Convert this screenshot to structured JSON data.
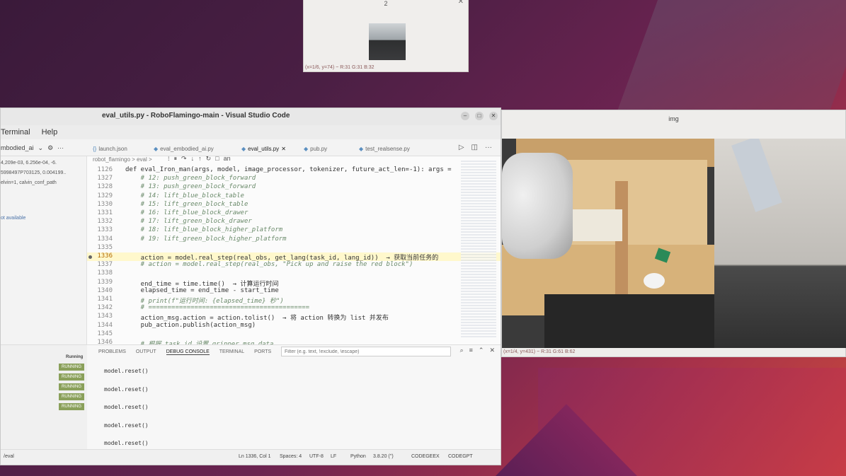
{
  "popup": {
    "title": "2",
    "status": "(x=1/6, y=74) ~ R:31 G:31 B:32"
  },
  "vscode": {
    "title": "eval_utils.py - RoboFlamingo-main - Visual Studio Code",
    "menu": [
      "Terminal",
      "Help"
    ],
    "explorer_label": "mbodied_ai",
    "tabs": [
      {
        "label": "launch.json",
        "active": false
      },
      {
        "label": "eval_embodied_ai.py",
        "active": false
      },
      {
        "label": "eval_utils.py",
        "active": true
      },
      {
        "label": "pub.py",
        "active": false
      },
      {
        "label": "test_realsense.py",
        "active": false
      }
    ],
    "breadcrumb": "robot_flamingo > eval >",
    "breadcrumb_tail": "an",
    "sidebar_lines": [
      "4,209e-03,  6.256e-04, -6.",
      "5998497P703125, 0.004199..",
      "elvin=1, calvin_conf_path",
      "ot available"
    ],
    "code_lines": [
      {
        "n": "1126",
        "text": "def eval_Iron_man(args, model, image_processor, tokenizer, future_act_len=-1): args =",
        "type": "kw"
      },
      {
        "n": "1327",
        "text": "    # 12: push_green_block_forward",
        "type": "comment"
      },
      {
        "n": "1328",
        "text": "    # 13: push_green_block_forward",
        "type": "comment"
      },
      {
        "n": "1329",
        "text": "    # 14: lift_blue_block_table",
        "type": "comment"
      },
      {
        "n": "1330",
        "text": "    # 15: lift_green_block_table",
        "type": "comment"
      },
      {
        "n": "1331",
        "text": "    # 16: lift_blue_block_drawer",
        "type": "comment"
      },
      {
        "n": "1332",
        "text": "    # 17: lift_green_block_drawer",
        "type": "comment"
      },
      {
        "n": "1333",
        "text": "    # 18: lift_blue_block_higher_platform",
        "type": "comment"
      },
      {
        "n": "1334",
        "text": "    # 19: lift_green_block_higher_platform",
        "type": "comment"
      },
      {
        "n": "1335",
        "text": "",
        "type": "code"
      },
      {
        "n": "1336",
        "text": "    action = model.real_step(real_obs, get_lang(task_id, lang_id))  → 获取当前任务的",
        "type": "hl"
      },
      {
        "n": "1337",
        "text": "    # action = model.real_step(real_obs, \"Pick up and raise the red block\")",
        "type": "comment"
      },
      {
        "n": "1338",
        "text": "",
        "type": "code"
      },
      {
        "n": "1339",
        "text": "    end_time = time.time()  → 计算运行时间",
        "type": "code"
      },
      {
        "n": "1340",
        "text": "    elapsed_time = end_time - start_time",
        "type": "code"
      },
      {
        "n": "1341",
        "text": "    # print(f\"运行时间: {elapsed_time} 秒\")",
        "type": "comment"
      },
      {
        "n": "1342",
        "text": "    # ==========================================",
        "type": "comment"
      },
      {
        "n": "1343",
        "text": "    action_msg.action = action.tolist()  → 将 action 转换为 list 并发布",
        "type": "code"
      },
      {
        "n": "1344",
        "text": "    pub_action.publish(action_msg)",
        "type": "code"
      },
      {
        "n": "1345",
        "text": "",
        "type": "code"
      },
      {
        "n": "1346",
        "text": "    # 根据 task_id 设置 gripper_msg.data",
        "type": "comment"
      }
    ],
    "panel_tabs": [
      "PROBLEMS",
      "OUTPUT",
      "DEBUG CONSOLE",
      "TERMINAL",
      "PORTS"
    ],
    "panel_active": "DEBUG CONSOLE",
    "filter_placeholder": "Filter (e.g. text, !exclude, \\escape)",
    "run_header": "Running",
    "run_badges": [
      "RUNNING",
      "RUNNING",
      "RUNNING",
      "RUNNING",
      "RUNNING"
    ],
    "console_lines": [
      "model.reset()",
      "model.reset()",
      "model.reset()",
      "model.reset()",
      "model.reset()"
    ],
    "status": {
      "left": "/eval",
      "position": "Ln 1336, Col 1",
      "spaces": "Spaces: 4",
      "encoding": "UTF-8",
      "eol": "LF",
      "language": "Python",
      "version": "3.8.20 ('')",
      "codegeex": "CODEGEEX",
      "codegpt": "CODEGPT"
    }
  },
  "img_window": {
    "title": "img",
    "status": "(x=1/4, y=431) ~ R:31 G:61 B:62"
  }
}
